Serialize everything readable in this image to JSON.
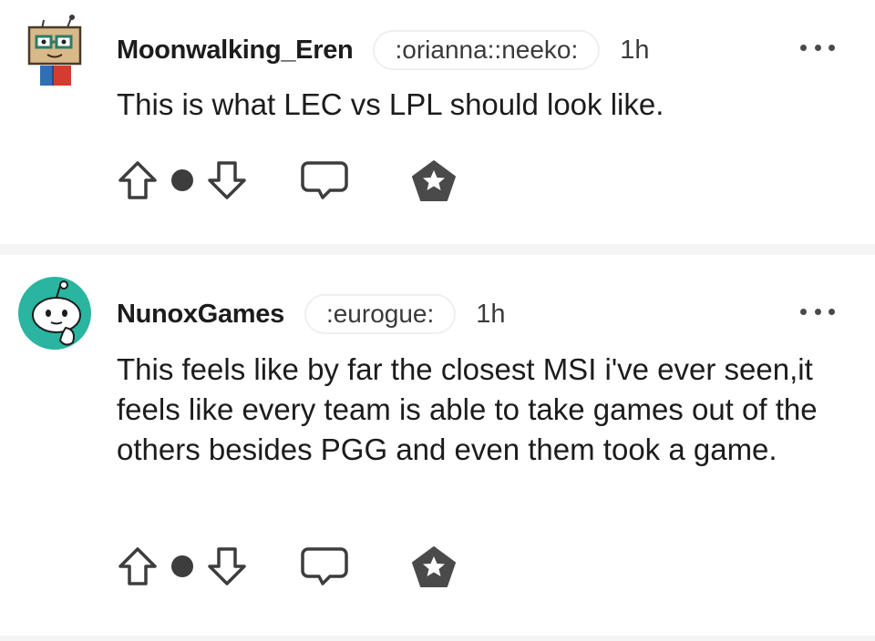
{
  "comments": [
    {
      "username": "Moonwalking_Eren",
      "flair": ":orianna::neeko:",
      "time": "1h",
      "text": "This is what LEC vs LPL should look like.",
      "score_label": "",
      "avatar_icon": "box-head-robot-avatar"
    },
    {
      "username": "NunoxGames",
      "flair": ":eurogue:",
      "time": "1h",
      "text": "This feels like by far the closest MSI i've ever seen,it feels like every team is able to take games out of the others besides PGG and even them took a game.",
      "score_label": "",
      "avatar_icon": "reddit-snoo-avatar"
    }
  ],
  "colors": {
    "text": "#1c1c1c",
    "icon": "#3d3d3d",
    "separator": "#f4f4f4",
    "avatar_teal": "#29b59f"
  },
  "icons": {
    "upvote": "arrow-up-icon",
    "downvote": "arrow-down-icon",
    "reply": "speech-bubble-icon",
    "award": "award-pentagon-icon",
    "more": "more-dots-icon"
  }
}
